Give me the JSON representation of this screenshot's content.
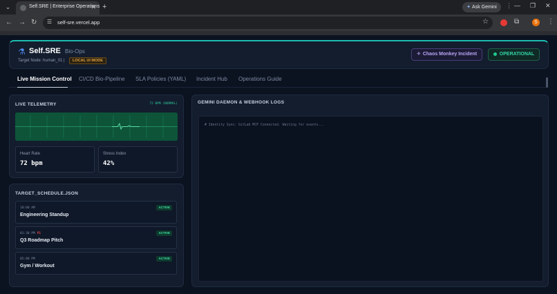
{
  "browser": {
    "tab_title": "Self.SRE | Enterprise Operations",
    "tab_close": "✕",
    "new_tab": "+",
    "url": "self-sre.vercel.app",
    "ask_gemini": "Ask Gemini",
    "avatar_initial": "S"
  },
  "header": {
    "brand": "Self.SRE",
    "subtitle": "Bio-Ops",
    "target_node": "Target Node: human_01 |",
    "mode_badge": "LOCAL UI MODE",
    "chaos_button": "Chaos Monkey Incident",
    "status": "OPERATIONAL",
    "status_color": "#22c98f"
  },
  "tabs": [
    {
      "label": "Live Mission Control",
      "active": true
    },
    {
      "label": "CI/CD Bio-Pipeline",
      "active": false
    },
    {
      "label": "SLA Policies (YAML)",
      "active": false
    },
    {
      "label": "Incident Hub",
      "active": false
    },
    {
      "label": "Operations Guide",
      "active": false
    }
  ],
  "telemetry": {
    "title": "LIVE TELEMETRY",
    "bpm_status": "72 BPM (NORMAL)",
    "heart_rate_label": "Heart Rate",
    "heart_rate_value": "72 bpm",
    "stress_label": "Stress Index",
    "stress_value": "42%"
  },
  "schedule": {
    "title": "TARGET_SCHEDULE.JSON",
    "items": [
      {
        "time": "10:00 AM",
        "priority": "",
        "name": "Engineering Standup",
        "status": "ACTIVE"
      },
      {
        "time": "01:30 PM",
        "priority": "P1",
        "name": "Q3 Roadmap Pitch",
        "status": "ACTIVE"
      },
      {
        "time": "05:00 PM",
        "priority": "",
        "name": "Gym / Workout",
        "status": "ACTIVE"
      }
    ]
  },
  "logs": {
    "title": "GEMINI DAEMON & WEBHOOK LOGS",
    "lines": [
      "# Identity Sync: GitLab MCP Connected. Waiting for events..."
    ]
  }
}
